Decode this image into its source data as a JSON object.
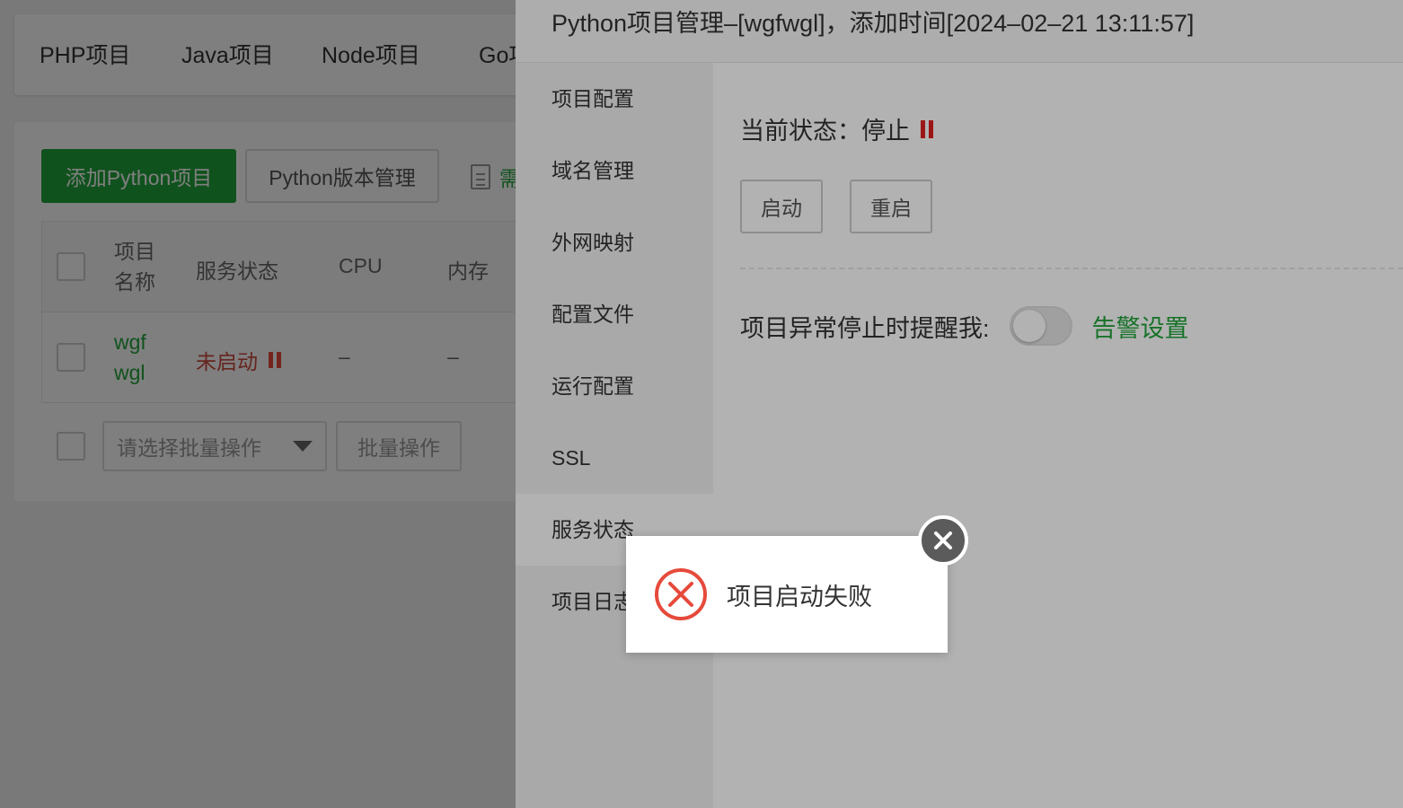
{
  "tabs": [
    "PHP项目",
    "Java项目",
    "Node项目",
    "Go项目"
  ],
  "toolbar": {
    "add_label": "添加Python项目",
    "version_label": "Python版本管理",
    "need_label": "需求反馈"
  },
  "table": {
    "headers": {
      "name": "项目\n名称",
      "status": "服务状态",
      "cpu": "CPU",
      "memory": "内存"
    },
    "rows": [
      {
        "name": "wgf\nwgl",
        "status": "未启动",
        "cpu": "–",
        "memory": "–"
      }
    ]
  },
  "batch": {
    "select_placeholder": "请选择批量操作",
    "button_label": "批量操作"
  },
  "drawer": {
    "title": "Python项目管理–[wgfwgl]，添加时间[2024–02–21 13:11:57]",
    "nav": [
      "项目配置",
      "域名管理",
      "外网映射",
      "配置文件",
      "运行配置",
      "SSL",
      "服务状态",
      "项目日志"
    ],
    "active_nav": "服务状态",
    "status_label": "当前状态：",
    "status_value": "停止",
    "start_label": "启动",
    "restart_label": "重启",
    "alert_label": "项目异常停止时提醒我:",
    "alert_toggle_on": false,
    "alert_link": "告警设置"
  },
  "toast": {
    "message": "项目启动失败",
    "icon": "error-circle-icon",
    "close_icon": "close-icon"
  },
  "colors": {
    "brand_green": "#20a53a",
    "error_red": "#e64a3b",
    "stopped_red": "#cc4a3f"
  }
}
